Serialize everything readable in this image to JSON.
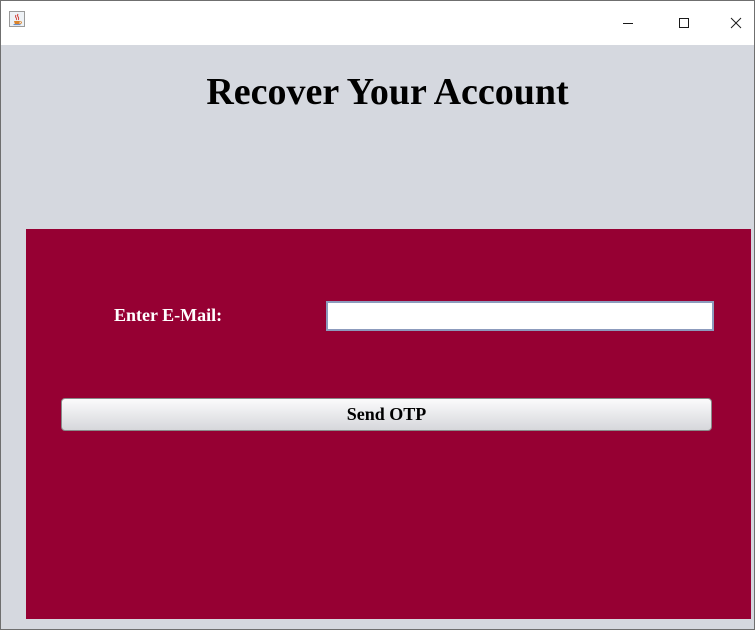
{
  "window": {
    "title": "",
    "controls": {
      "minimize_icon": "minimize-icon",
      "maximize_icon": "maximize-icon",
      "close_icon": "close-icon"
    },
    "app_icon": "java-coffee-cup-icon"
  },
  "page": {
    "heading": "Recover Your Account"
  },
  "form": {
    "email_label": "Enter E-Mail:",
    "email_value": "",
    "email_placeholder": "",
    "send_button_label": "Send OTP"
  },
  "colors": {
    "background": "#d5d8df",
    "panel": "#960033",
    "label_text": "#ffffff",
    "input_border": "#8c9bbd"
  }
}
